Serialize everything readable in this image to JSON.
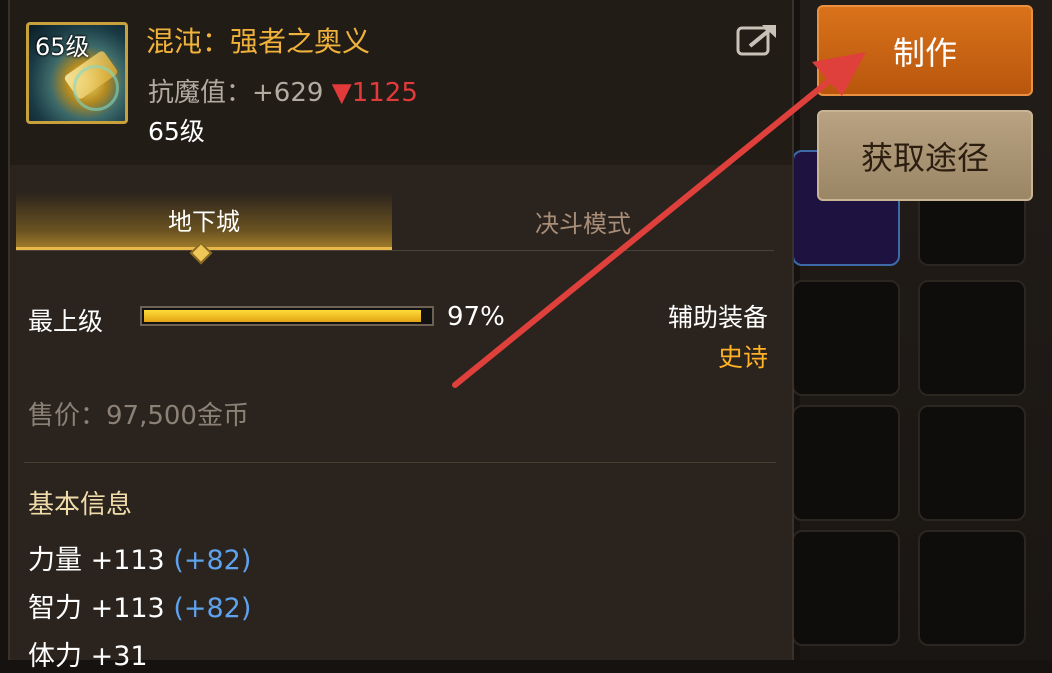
{
  "item": {
    "icon_level": "65级",
    "name": "混沌：强者之奥义",
    "stat_label": "抗魔值：",
    "stat_value": "+629",
    "stat_diff": "▼1125",
    "level": "65级",
    "share_icon": "share-icon"
  },
  "tabs": [
    {
      "label": "地下城",
      "active": true
    },
    {
      "label": "决斗模式",
      "active": false
    }
  ],
  "grade": {
    "label": "最上级",
    "percent_text": "97%",
    "percent_value": 97
  },
  "slot": {
    "type": "辅助装备",
    "rarity": "史诗"
  },
  "price": "售价：97,500金币",
  "basic_info": {
    "title": "基本信息",
    "attributes": [
      {
        "base": "力量 +113 ",
        "bonus": "(+82)"
      },
      {
        "base": "智力 +113 ",
        "bonus": "(+82)"
      },
      {
        "base": "体力 +31",
        "bonus": ""
      }
    ]
  },
  "actions": {
    "make": "制作",
    "source": "获取途径"
  },
  "colors": {
    "accent_gold": "#f0b23a",
    "rarity_orange": "#ffb225",
    "bonus_blue": "#5ea2ee",
    "down_red": "#e23a3a",
    "make_button": "#c8641a",
    "annotation_arrow": "#e0403c"
  }
}
